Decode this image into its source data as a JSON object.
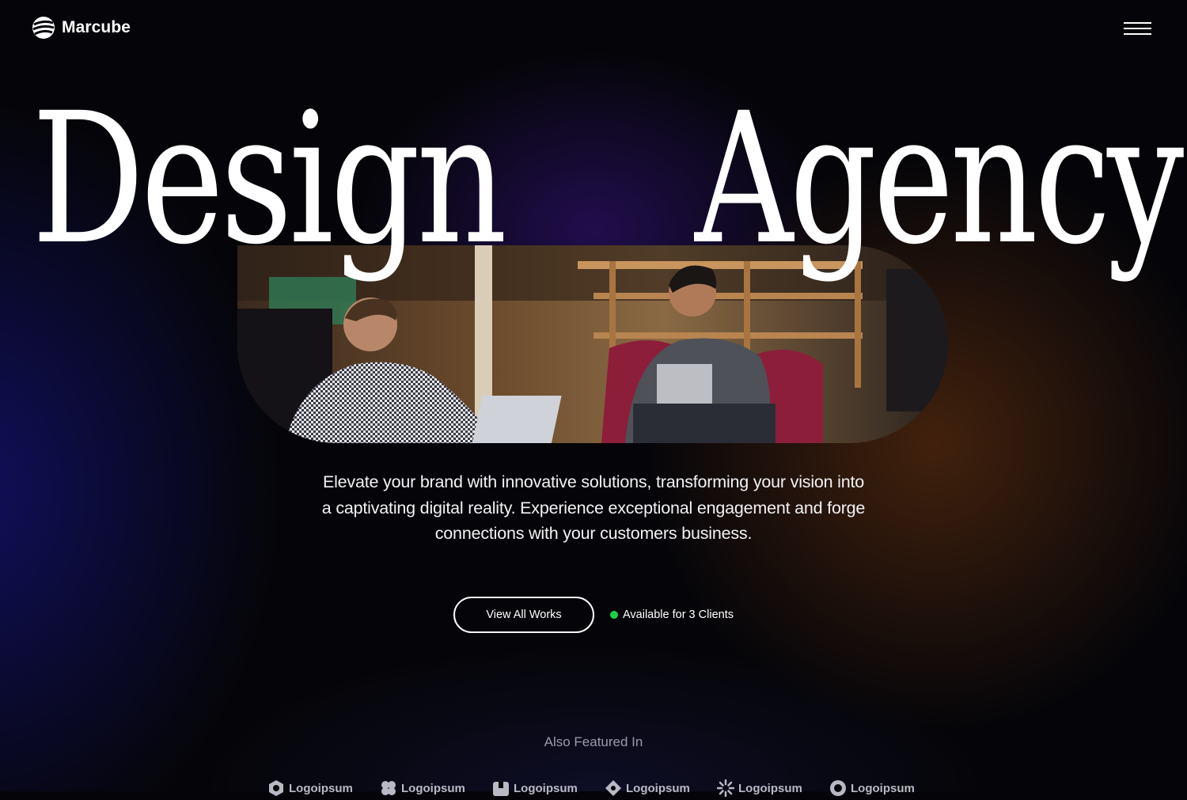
{
  "brand": {
    "name": "Marcube",
    "logo_icon": "globe-stripes-icon"
  },
  "nav": {
    "menu_icon": "hamburger-menu-icon"
  },
  "hero": {
    "title_left": "Design",
    "title_right": "Agency",
    "tagline": "Elevate your brand with innovative solutions, transforming your vision into a captivating digital reality. Experience exceptional engagement and forge connections with your customers business.",
    "image_subject": "two-men-talking-photo"
  },
  "cta": {
    "button_label": "View All Works",
    "availability": "Available for 3 Clients",
    "status_color": "#1fcf4a"
  },
  "featured": {
    "label": "Also Featured In",
    "logos": [
      {
        "name": "Logoipsum",
        "icon": "hexagon-logo-icon"
      },
      {
        "name": "Logoipsum",
        "icon": "clover-logo-icon"
      },
      {
        "name": "Logoipsum",
        "icon": "square-logo-icon"
      },
      {
        "name": "Logoipsum",
        "icon": "diamond-logo-icon"
      },
      {
        "name": "Logoipsum",
        "icon": "burst-logo-icon"
      },
      {
        "name": "Logoipsum",
        "icon": "ring-logo-icon"
      }
    ]
  },
  "colors": {
    "background": "#050509",
    "accent_blue": "#1a18a0",
    "accent_orange": "#964812"
  }
}
